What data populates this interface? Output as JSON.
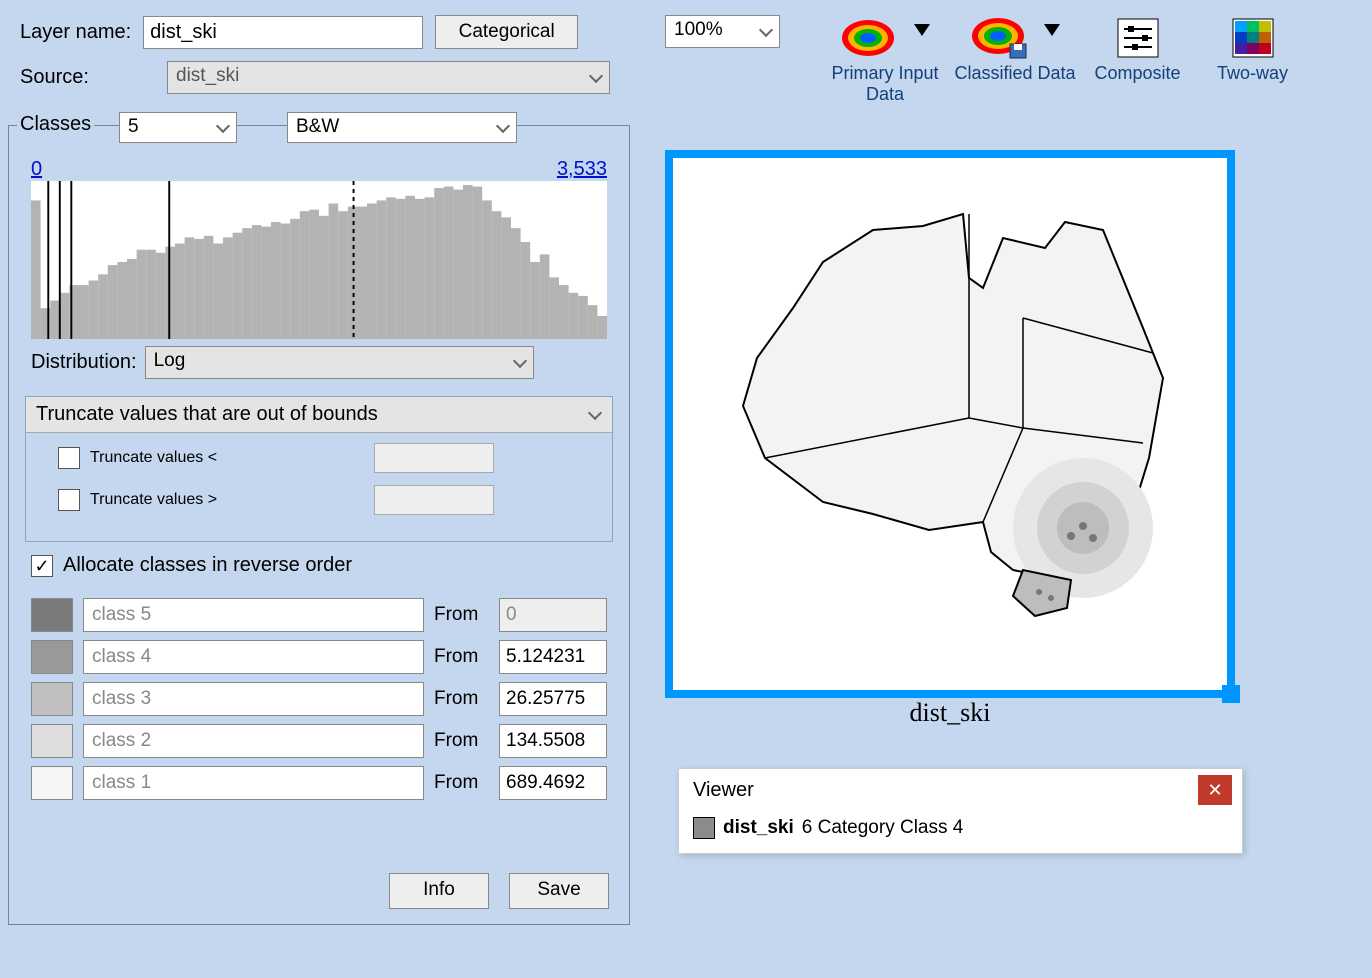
{
  "header": {
    "layer_name_label": "Layer name:",
    "layer_name_value": "dist_ski",
    "categorical_btn": "Categorical",
    "source_label": "Source:",
    "source_value": "dist_ski",
    "zoom_value": "100%"
  },
  "toolbar": {
    "primary_input": "Primary Input Data",
    "classified": "Classified Data",
    "composite": "Composite",
    "twoway": "Two-way"
  },
  "classes": {
    "legend": "Classes",
    "count": "5",
    "style": "B&W",
    "range_min": "0",
    "range_max": "3,533",
    "distribution_label": "Distribution:",
    "distribution_value": "Log",
    "truncate_header": "Truncate values that are out of bounds",
    "truncate_lt": "Truncate values <",
    "truncate_gt": "Truncate values >",
    "allocate_reverse": "Allocate classes in reverse order",
    "from_label": "From",
    "rows": [
      {
        "name": "class 5",
        "from": "0",
        "color": "#7a7a7a",
        "disabled": true
      },
      {
        "name": "class 4",
        "from": "5.124231",
        "color": "#999999",
        "disabled": false
      },
      {
        "name": "class 3",
        "from": "26.25775",
        "color": "#c0c0c0",
        "disabled": false
      },
      {
        "name": "class 2",
        "from": "134.5508",
        "color": "#dedede",
        "disabled": false
      },
      {
        "name": "class 1",
        "from": "689.4692",
        "color": "#f5f5f5",
        "disabled": false
      }
    ],
    "info_btn": "Info",
    "save_btn": "Save"
  },
  "map": {
    "caption": "dist_ski"
  },
  "viewer": {
    "title": "Viewer",
    "layer": "dist_ski",
    "extra": "6 Category Class 4"
  },
  "chart_data": {
    "type": "bar",
    "note": "Histogram of dist_ski values, log-scaled x axis. Bar heights approximate (% of max height). Vertical guide lines mark class break positions.",
    "x_range": [
      0,
      3533
    ],
    "values_pct": [
      90,
      20,
      25,
      30,
      35,
      35,
      38,
      42,
      48,
      50,
      52,
      58,
      58,
      56,
      60,
      62,
      66,
      65,
      67,
      62,
      66,
      69,
      72,
      74,
      73,
      76,
      75,
      78,
      83,
      84,
      80,
      88,
      83,
      86,
      86,
      88,
      90,
      92,
      91,
      93,
      91,
      92,
      98,
      99,
      97,
      100,
      99,
      90,
      83,
      79,
      72,
      63,
      50,
      55,
      40,
      35,
      30,
      28,
      22,
      15
    ],
    "class_break_positions_pct": [
      3,
      5,
      7,
      24,
      56
    ]
  }
}
